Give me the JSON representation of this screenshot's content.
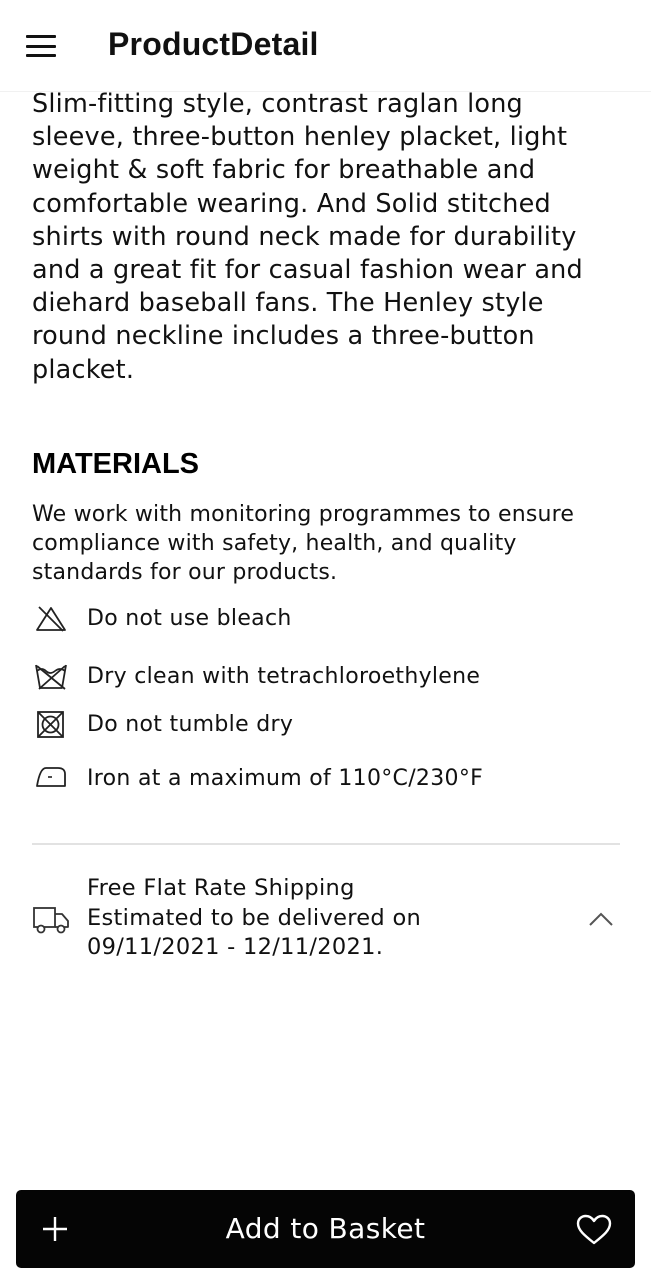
{
  "app_bar": {
    "title": "ProductDetail",
    "menu_icon": "hamburger-menu-icon"
  },
  "product": {
    "description": "Slim-fitting style, contrast raglan long sleeve, three-button henley placket, light weight & soft fabric for breathable and comfortable wearing. And Solid stitched shirts with round neck made for durability and a great fit for casual fashion wear and diehard baseball fans. The Henley style round neckline includes a three-button placket."
  },
  "materials": {
    "heading": "MATERIALS",
    "text": "We work with monitoring programmes to ensure compliance with safety, health, and quality standards for our products.",
    "care_items": [
      {
        "icon": "no-bleach-icon",
        "label": "Do not use bleach"
      },
      {
        "icon": "dry-clean-icon",
        "label": "Dry clean with tetrachloroethylene"
      },
      {
        "icon": "no-tumble-dry-icon",
        "label": "Do not tumble dry"
      },
      {
        "icon": "iron-icon",
        "label": "Iron at a maximum of 110°C/230°F"
      }
    ]
  },
  "shipping": {
    "icon": "delivery-truck-icon",
    "title": "Free Flat Rate Shipping",
    "estimate_line": "Estimated to be delivered on",
    "dates": "09/11/2021 - 12/11/2021.",
    "toggle_icon": "chevron-up-icon"
  },
  "basket_bar": {
    "label": "Add to Basket",
    "add_icon": "plus-icon",
    "favorite_icon": "heart-icon",
    "background": "#050505",
    "text_color": "#ffffff"
  }
}
